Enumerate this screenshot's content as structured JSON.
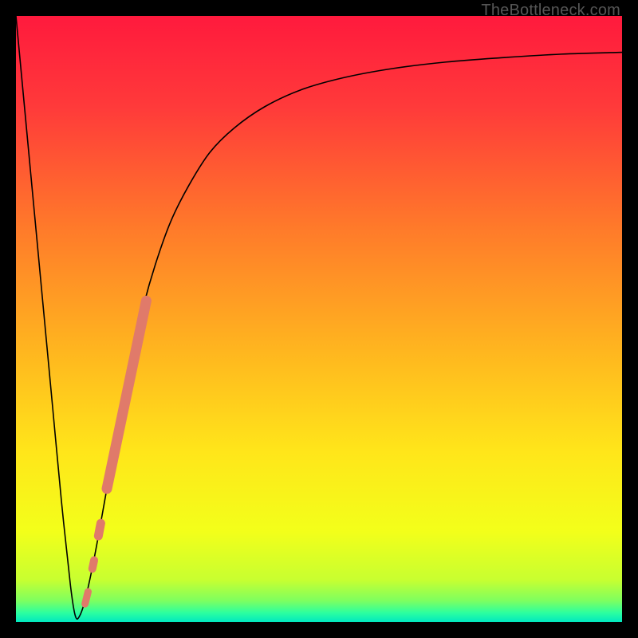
{
  "watermark": "TheBottleneck.com",
  "chart_data": {
    "type": "line",
    "title": "",
    "xlabel": "",
    "ylabel": "",
    "xlim": [
      0,
      100
    ],
    "ylim": [
      0,
      100
    ],
    "grid": false,
    "legend": false,
    "background_gradient_stops": [
      {
        "offset": 0.0,
        "color": "#ff1a3d"
      },
      {
        "offset": 0.15,
        "color": "#ff3a3a"
      },
      {
        "offset": 0.35,
        "color": "#ff7a2a"
      },
      {
        "offset": 0.55,
        "color": "#ffb51f"
      },
      {
        "offset": 0.72,
        "color": "#ffe61a"
      },
      {
        "offset": 0.85,
        "color": "#f3ff1a"
      },
      {
        "offset": 0.93,
        "color": "#c8ff30"
      },
      {
        "offset": 0.965,
        "color": "#7dff60"
      },
      {
        "offset": 0.985,
        "color": "#2bffa0"
      },
      {
        "offset": 1.0,
        "color": "#00e8c0"
      }
    ],
    "series": [
      {
        "name": "bottleneck-curve",
        "stroke": "#000000",
        "stroke_width": 1.6,
        "x": [
          0.0,
          1.5,
          3.0,
          4.5,
          6.0,
          7.5,
          9.0,
          9.8,
          10.5,
          11.5,
          13.0,
          15.0,
          17.0,
          19.0,
          21.0,
          23.0,
          25.5,
          28.5,
          32.0,
          36.0,
          41.0,
          47.0,
          54.0,
          62.0,
          71.0,
          80.0,
          90.0,
          100.0
        ],
        "y": [
          100.0,
          84.0,
          68.0,
          52.0,
          36.0,
          20.0,
          6.0,
          1.0,
          1.0,
          4.0,
          11.0,
          22.0,
          33.0,
          43.0,
          52.0,
          59.0,
          66.0,
          72.0,
          77.5,
          81.5,
          85.0,
          87.8,
          89.8,
          91.3,
          92.4,
          93.1,
          93.7,
          94.0
        ]
      }
    ],
    "highlight_segments": [
      {
        "name": "highlight-thick",
        "stroke": "#e07a6a",
        "stroke_width": 13,
        "linecap": "round",
        "points": [
          {
            "x": 15.0,
            "y": 22.0
          },
          {
            "x": 21.5,
            "y": 53.0
          }
        ]
      },
      {
        "name": "highlight-dot-1",
        "stroke": "#e07a6a",
        "stroke_width": 11,
        "linecap": "round",
        "points": [
          {
            "x": 13.6,
            "y": 14.2
          },
          {
            "x": 14.0,
            "y": 16.3
          }
        ]
      },
      {
        "name": "highlight-dot-2",
        "stroke": "#e07a6a",
        "stroke_width": 10,
        "linecap": "round",
        "points": [
          {
            "x": 12.6,
            "y": 8.8
          },
          {
            "x": 12.9,
            "y": 10.2
          }
        ]
      },
      {
        "name": "highlight-dot-3",
        "stroke": "#e07a6a",
        "stroke_width": 9,
        "linecap": "round",
        "points": [
          {
            "x": 11.4,
            "y": 3.0
          },
          {
            "x": 11.9,
            "y": 5.0
          }
        ]
      }
    ]
  }
}
